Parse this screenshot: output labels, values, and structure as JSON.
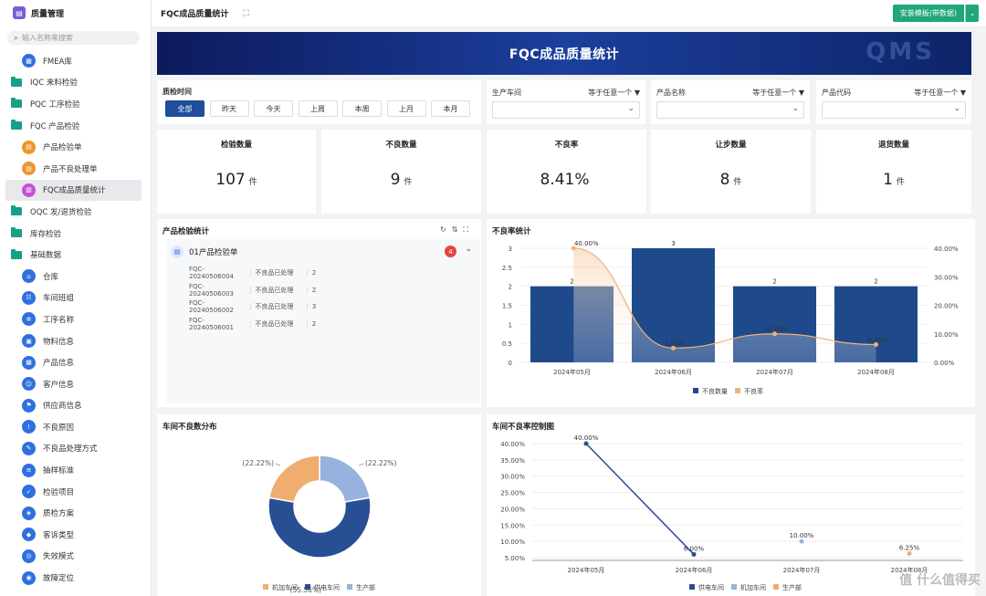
{
  "app": {
    "title": "质量管理",
    "logo_icon": "clipboard-icon"
  },
  "search": {
    "placeholder": "输入名称来搜索"
  },
  "sidebar": {
    "items": [
      {
        "label": "FMEA库",
        "level": 1,
        "icon": "chart-icon",
        "color": "#2f6fe0"
      },
      {
        "label": "IQC 来料检验",
        "level": 0,
        "icon": "folder-icon"
      },
      {
        "label": "PQC 工序检验",
        "level": 0,
        "icon": "folder-icon"
      },
      {
        "label": "FQC 产品检验",
        "level": 0,
        "icon": "folder-icon"
      },
      {
        "label": "产品检验单",
        "level": 1,
        "icon": "form-icon",
        "color": "#f0952e"
      },
      {
        "label": "产品不良处理单",
        "level": 1,
        "icon": "form-icon",
        "color": "#f0952e"
      },
      {
        "label": "FQC成品质量统计",
        "level": 1,
        "icon": "stats-icon",
        "color": "#c64fd8",
        "active": true
      },
      {
        "label": "OQC 发/退货检验",
        "level": 0,
        "icon": "folder-icon"
      },
      {
        "label": "库存检验",
        "level": 0,
        "icon": "folder-icon"
      },
      {
        "label": "基础数据",
        "level": 0,
        "icon": "folder-icon"
      },
      {
        "label": "仓库",
        "level": 1,
        "icon": "home-icon",
        "color": "#2f6fe0"
      },
      {
        "label": "车间班组",
        "level": 1,
        "icon": "team-icon",
        "color": "#2f6fe0"
      },
      {
        "label": "工序名称",
        "level": 1,
        "icon": "gear-icon",
        "color": "#2f6fe0"
      },
      {
        "label": "物料信息",
        "level": 1,
        "icon": "box-icon",
        "color": "#2f6fe0"
      },
      {
        "label": "产品信息",
        "level": 1,
        "icon": "product-icon",
        "color": "#2f6fe0"
      },
      {
        "label": "客户信息",
        "level": 1,
        "icon": "user-icon",
        "color": "#2f6fe0"
      },
      {
        "label": "供应商信息",
        "level": 1,
        "icon": "supplier-icon",
        "color": "#2f6fe0"
      },
      {
        "label": "不良原因",
        "level": 1,
        "icon": "warning-icon",
        "color": "#2f6fe0"
      },
      {
        "label": "不良品处理方式",
        "level": 1,
        "icon": "tool-icon",
        "color": "#2f6fe0"
      },
      {
        "label": "抽样标准",
        "level": 1,
        "icon": "sample-icon",
        "color": "#2f6fe0"
      },
      {
        "label": "检验项目",
        "level": 1,
        "icon": "check-icon",
        "color": "#2f6fe0"
      },
      {
        "label": "质检方案",
        "level": 1,
        "icon": "shield-icon",
        "color": "#2f6fe0"
      },
      {
        "label": "客诉类型",
        "level": 1,
        "icon": "tag-icon",
        "color": "#2f6fe0"
      },
      {
        "label": "失效模式",
        "level": 1,
        "icon": "mode-icon",
        "color": "#2f6fe0"
      },
      {
        "label": "故障定位",
        "level": 1,
        "icon": "locate-icon",
        "color": "#2f6fe0"
      }
    ]
  },
  "header": {
    "page_title": "FQC成品质量统计",
    "expand_icon": "expand-icon",
    "install_label": "安装模板(带数据)",
    "dropdown_icon": "chevron-down-icon"
  },
  "banner": {
    "title": "FQC成品质量统计",
    "watermark": "QMS"
  },
  "filters": {
    "time_label": "质检时间",
    "time_buttons": [
      "全部",
      "昨天",
      "今天",
      "上周",
      "本周",
      "上月",
      "本月"
    ],
    "time_active": 0,
    "selects": [
      {
        "label": "生产车间",
        "op": "等于任意一个 ▼"
      },
      {
        "label": "产品名称",
        "op": "等于任意一个 ▼"
      },
      {
        "label": "产品代码",
        "op": "等于任意一个 ▼"
      }
    ]
  },
  "stats": [
    {
      "label": "检验数量",
      "value": "107",
      "unit": "件"
    },
    {
      "label": "不良数量",
      "value": "9",
      "unit": "件"
    },
    {
      "label": "不良率",
      "value": "8.41%",
      "unit": ""
    },
    {
      "label": "让步数量",
      "value": "8",
      "unit": "件"
    },
    {
      "label": "退货数量",
      "value": "1",
      "unit": "件"
    }
  ],
  "inspection": {
    "title": "产品检验统计",
    "group_title": "01产品检验单",
    "badge": "4",
    "records": [
      {
        "code": "FQC-20240506004",
        "status": "不良品已处理",
        "qty": "2"
      },
      {
        "code": "FQC-20240506003",
        "status": "不良品已处理",
        "qty": "2"
      },
      {
        "code": "FQC-20240506002",
        "status": "不良品已处理",
        "qty": "3"
      },
      {
        "code": "FQC-20240506001",
        "status": "不良品已处理",
        "qty": "2"
      }
    ]
  },
  "chart_data": [
    {
      "title": "不良率统计",
      "type": "bar",
      "categories": [
        "2024年05月",
        "2024年06月",
        "2024年07月",
        "2024年08月"
      ],
      "series": [
        {
          "name": "不良数量",
          "type": "bar",
          "values": [
            2,
            3,
            2,
            2
          ],
          "color": "#1e4a8c"
        },
        {
          "name": "不良率",
          "type": "line",
          "values": [
            40,
            5,
            10,
            6.25
          ],
          "labels": [
            "40.00%",
            "5.00%",
            "10.00%",
            "6.25%"
          ],
          "color": "#f0b27a"
        }
      ],
      "ylim": [
        0,
        3
      ],
      "yticks": [
        "0",
        "0.5",
        "1",
        "1.5",
        "2",
        "2.5",
        "3"
      ],
      "y2lim": [
        0,
        40
      ],
      "y2ticks": [
        "0.00%",
        "10.00%",
        "20.00%",
        "30.00%",
        "40.00%"
      ],
      "legend": "bottom"
    },
    {
      "title": "车间不良数分布",
      "type": "pie",
      "slices": [
        {
          "name": "机加车间",
          "value": 22.22,
          "label": "(22.22%)",
          "color": "#f0ad70"
        },
        {
          "name": "供电车间",
          "value": 55.56,
          "label": "(55.56%)",
          "color": "#284f94"
        },
        {
          "name": "生产部",
          "value": 22.22,
          "label": "(22.22%)",
          "color": "#97b2dd"
        }
      ],
      "legend": "bottom"
    },
    {
      "title": "车间不良率控制图",
      "type": "line",
      "categories": [
        "2024年05月",
        "2024年06月",
        "2024年07月",
        "2024年08月"
      ],
      "series": [
        {
          "name": "供电车间",
          "values": [
            40,
            6,
            null,
            null
          ],
          "labels": [
            "40.00%",
            "6.00%",
            "",
            ""
          ],
          "color": "#284f94"
        },
        {
          "name": "机加车间",
          "values": [
            null,
            null,
            10,
            null
          ],
          "labels": [
            "",
            "",
            "10.00%",
            ""
          ],
          "color": "#97b2dd"
        },
        {
          "name": "生产部",
          "values": [
            null,
            null,
            null,
            6.25
          ],
          "labels": [
            "",
            "",
            "",
            "6.25%"
          ],
          "color": "#f0ad70"
        }
      ],
      "ylim": [
        5,
        40
      ],
      "yticks": [
        "5.00%",
        "10.00%",
        "15.00%",
        "20.00%",
        "25.00%",
        "30.00%",
        "35.00%",
        "40.00%"
      ],
      "legend": "bottom"
    }
  ],
  "watermark": "值 什么值得买"
}
